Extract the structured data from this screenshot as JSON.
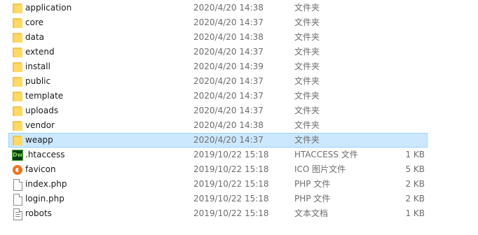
{
  "files": [
    {
      "name": "application",
      "date": "2020/4/20 14:38",
      "type": "文件夹",
      "size": "",
      "icon": "folder-icon",
      "selected": false
    },
    {
      "name": "core",
      "date": "2020/4/20 14:37",
      "type": "文件夹",
      "size": "",
      "icon": "folder-icon",
      "selected": false
    },
    {
      "name": "data",
      "date": "2020/4/20 14:38",
      "type": "文件夹",
      "size": "",
      "icon": "folder-icon",
      "selected": false
    },
    {
      "name": "extend",
      "date": "2020/4/20 14:37",
      "type": "文件夹",
      "size": "",
      "icon": "folder-icon",
      "selected": false
    },
    {
      "name": "install",
      "date": "2020/4/20 14:39",
      "type": "文件夹",
      "size": "",
      "icon": "folder-icon",
      "selected": false
    },
    {
      "name": "public",
      "date": "2020/4/20 14:37",
      "type": "文件夹",
      "size": "",
      "icon": "folder-icon",
      "selected": false
    },
    {
      "name": "template",
      "date": "2020/4/20 14:37",
      "type": "文件夹",
      "size": "",
      "icon": "folder-icon",
      "selected": false
    },
    {
      "name": "uploads",
      "date": "2020/4/20 14:37",
      "type": "文件夹",
      "size": "",
      "icon": "folder-icon",
      "selected": false
    },
    {
      "name": "vendor",
      "date": "2020/4/20 14:38",
      "type": "文件夹",
      "size": "",
      "icon": "folder-icon",
      "selected": false
    },
    {
      "name": "weapp",
      "date": "2020/4/20 14:37",
      "type": "文件夹",
      "size": "",
      "icon": "folder-icon",
      "selected": true
    },
    {
      "name": ".htaccess",
      "date": "2019/10/22 15:18",
      "type": "HTACCESS 文件",
      "size": "1 KB",
      "icon": "dreamweaver-file-icon",
      "selected": false
    },
    {
      "name": "favicon",
      "date": "2019/10/22 15:18",
      "type": "ICO 图片文件",
      "size": "5 KB",
      "icon": "favicon-file-icon",
      "selected": false
    },
    {
      "name": "index.php",
      "date": "2019/10/22 15:18",
      "type": "PHP 文件",
      "size": "2 KB",
      "icon": "php-file-icon",
      "selected": false
    },
    {
      "name": "login.php",
      "date": "2019/10/22 15:18",
      "type": "PHP 文件",
      "size": "2 KB",
      "icon": "php-file-icon",
      "selected": false
    },
    {
      "name": "robots",
      "date": "2019/10/22 15:18",
      "type": "文本文档",
      "size": "1 KB",
      "icon": "text-file-icon",
      "selected": false
    }
  ],
  "icon_labels": {
    "dreamweaver": "Dw"
  },
  "colors": {
    "selection_bg": "#cce8ff",
    "selection_border": "#99d1ff",
    "folder": "#ffd965"
  }
}
